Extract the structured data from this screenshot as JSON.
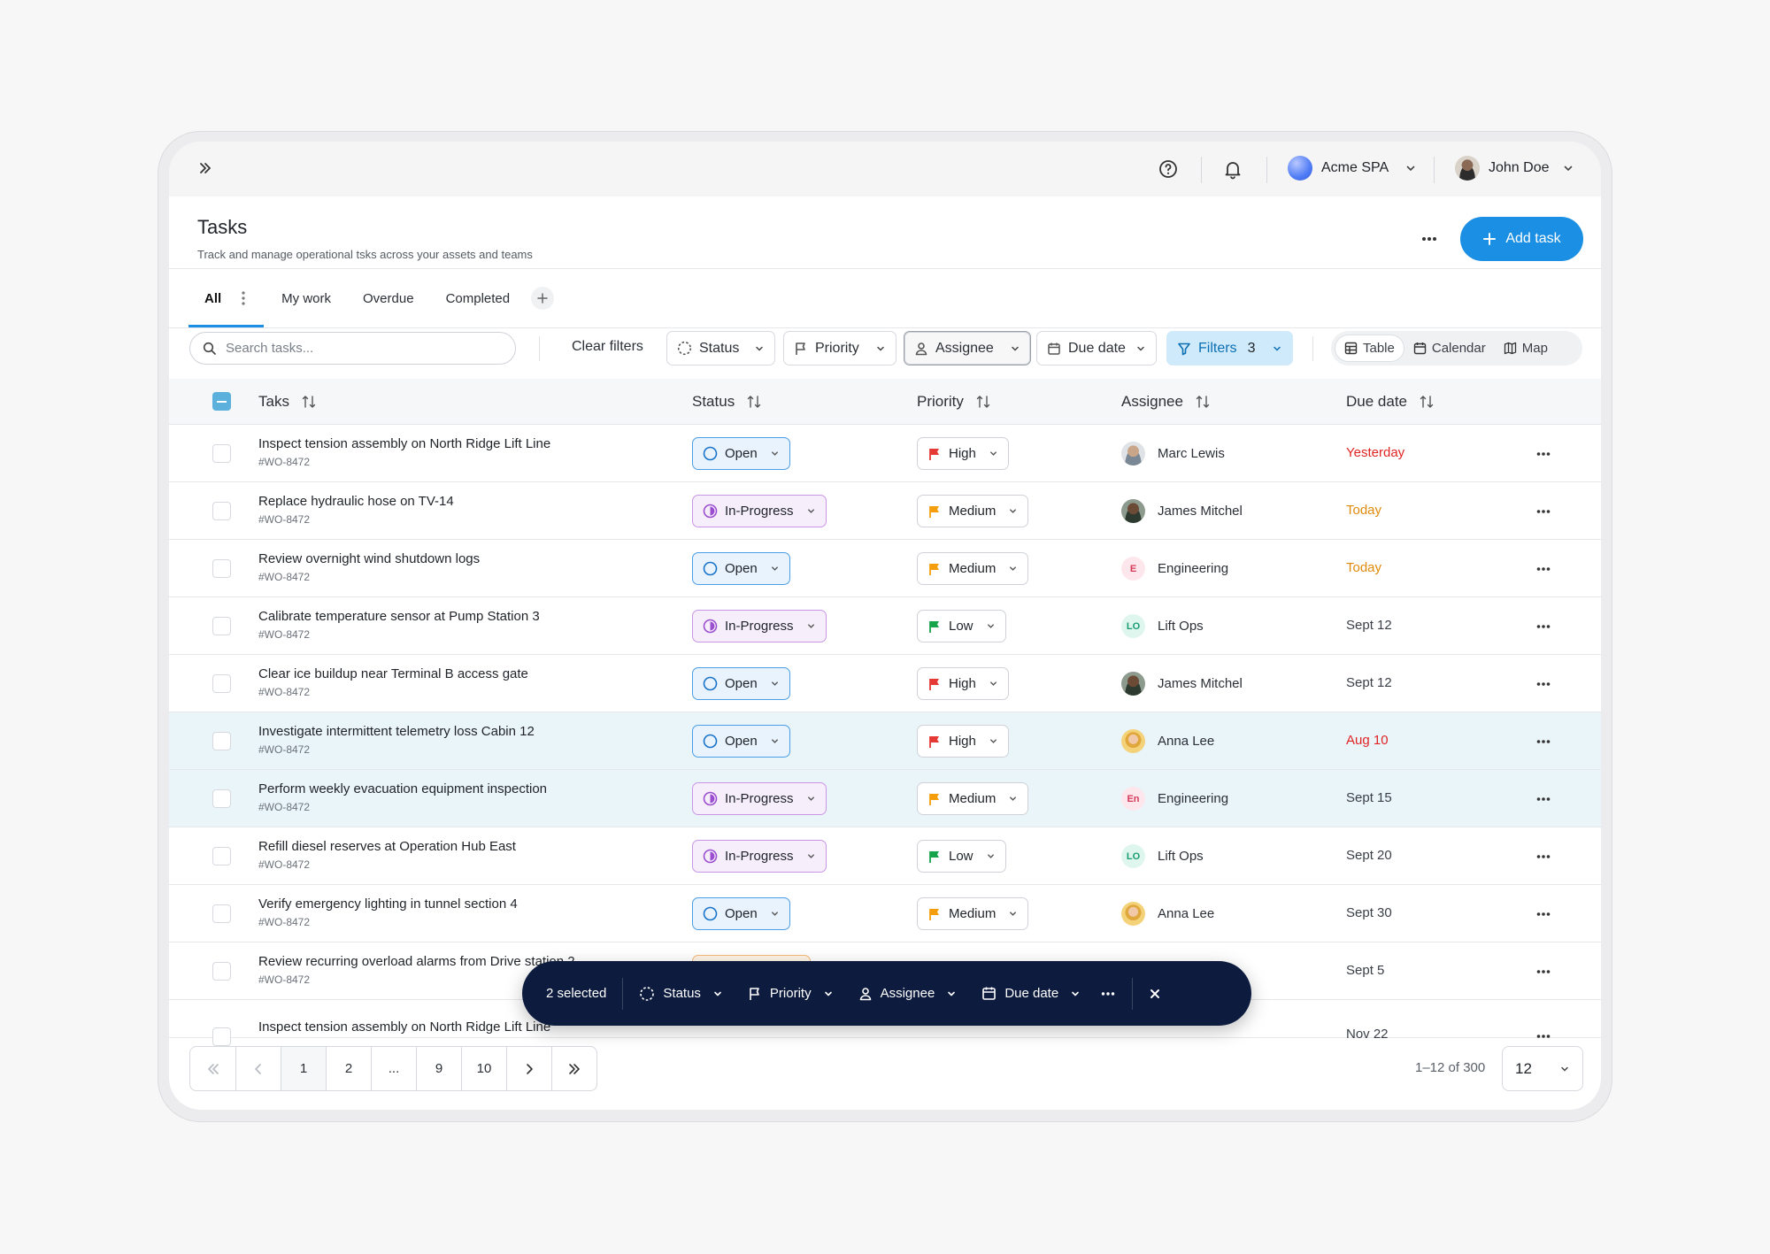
{
  "topbar": {
    "org": "Acme SPA",
    "user": "John Doe"
  },
  "header": {
    "title": "Tasks",
    "subtitle": "Track and manage operational tsks across your assets and teams",
    "add_label": "Add task"
  },
  "tabs": [
    "All",
    "My work",
    "Overdue",
    "Completed"
  ],
  "toolbar": {
    "search_placeholder": "Search tasks...",
    "clear": "Clear filters",
    "status": "Status",
    "priority": "Priority",
    "assignee": "Assignee",
    "due": "Due date",
    "filters": "Filters",
    "filters_count": "3"
  },
  "views": [
    "Table",
    "Calendar",
    "Map"
  ],
  "columns": {
    "task": "Taks",
    "status": "Status",
    "priority": "Priority",
    "assignee": "Assignee",
    "due": "Due date"
  },
  "colors": {
    "accent": "#1a8fe3",
    "overdue": "#e02424",
    "today": "#e08a0b",
    "high": "#e53935",
    "medium": "#f59e0b",
    "low": "#16a34a"
  },
  "rows": [
    {
      "name": "Inspect tension assembly on North Ridge Lift Line",
      "id": "#WO-8472",
      "status": "Open",
      "priority": "High",
      "assignee": "Marc Lewis",
      "av": "photo1",
      "due": "Yesterday",
      "due_kind": "overdue"
    },
    {
      "name": "Replace hydraulic hose on TV-14",
      "id": "#WO-8472",
      "status": "In-Progress",
      "priority": "Medium",
      "assignee": "James Mitchel",
      "av": "photo2",
      "due": "Today",
      "due_kind": "today"
    },
    {
      "name": "Review overnight wind shutdown logs",
      "id": "#WO-8472",
      "status": "Open",
      "priority": "Medium",
      "assignee": "Engineering",
      "av": "E",
      "due": "Today",
      "due_kind": "today"
    },
    {
      "name": "Calibrate temperature sensor at Pump Station 3",
      "id": "#WO-8472",
      "status": "In-Progress",
      "priority": "Low",
      "assignee": "Lift Ops",
      "av": "LO",
      "due": "Sept 12",
      "due_kind": "normal"
    },
    {
      "name": "Clear ice buildup near Terminal B access gate",
      "id": "#WO-8472",
      "status": "Open",
      "priority": "High",
      "assignee": "James Mitchel",
      "av": "photo2",
      "due": "Sept 12",
      "due_kind": "normal"
    },
    {
      "name": "Investigate intermittent telemetry loss Cabin 12",
      "id": "#WO-8472",
      "status": "Open",
      "priority": "High",
      "assignee": "Anna Lee",
      "av": "photo3",
      "due": "Aug 10",
      "due_kind": "overdue",
      "hl": true
    },
    {
      "name": "Perform weekly evacuation equipment inspection",
      "id": "#WO-8472",
      "status": "In-Progress",
      "priority": "Medium",
      "assignee": "Engineering",
      "av": "En",
      "due": "Sept 15",
      "due_kind": "normal",
      "hl": true
    },
    {
      "name": "Refill diesel reserves at Operation Hub East",
      "id": "#WO-8472",
      "status": "In-Progress",
      "priority": "Low",
      "assignee": "Lift Ops",
      "av": "LO",
      "due": "Sept 20",
      "due_kind": "normal"
    },
    {
      "name": "Verify emergency lighting in tunnel section 4",
      "id": "#WO-8472",
      "status": "Open",
      "priority": "Medium",
      "assignee": "Anna Lee",
      "av": "photo3",
      "due": "Sept 30",
      "due_kind": "normal"
    },
    {
      "name": "Review recurring overload alarms from Drive station 2",
      "id": "#WO-8472",
      "due": "Sept 5",
      "due_kind": "normal",
      "partial": true
    },
    {
      "name": "Inspect tension assembly on North Ridge Lift Line",
      "id": "",
      "due": "Nov 22",
      "due_kind": "normal",
      "partial": true,
      "cut": true
    }
  ],
  "pagination": {
    "pages": [
      "1",
      "2",
      "...",
      "9",
      "10"
    ],
    "range": "1–12 of 300",
    "per_page": "12"
  },
  "bulk": {
    "selected": "2 selected",
    "status": "Status",
    "priority": "Priority",
    "assignee": "Assignee",
    "due": "Due date"
  }
}
